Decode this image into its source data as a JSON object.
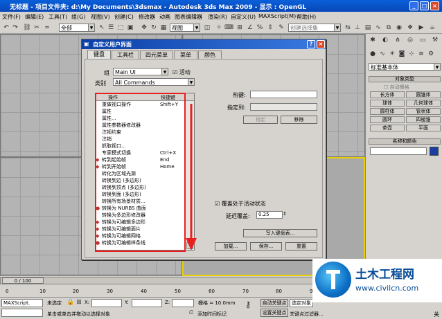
{
  "window": {
    "title": "无标题  - 项目文件夹: d:\\My Documents\\3dsmax   - Autodesk 3ds Max  2009   - 显示 : OpenGL",
    "minimize_icon": "minimize-icon",
    "maximize_icon": "maximize-icon",
    "close_icon": "close-icon"
  },
  "menubar": {
    "items": [
      "文件(F)",
      "编辑(E)",
      "工具(T)",
      "组(G)",
      "视图(V)",
      "创建(C)",
      "修改器",
      "动画",
      "图表编辑器",
      "渲染(R)",
      "自定义(U)",
      "MAXScript(M)",
      "帮助(H)"
    ]
  },
  "toolbar": {
    "selection_filter": "全部",
    "coord_system": "视图",
    "named_selection": "创建选择集"
  },
  "viewports": {
    "top_right_label": "",
    "bottom_left_label": ""
  },
  "command_panel": {
    "category": "标准基本体",
    "rollout_object_type": "对象类型",
    "autogrid": "自动栅格",
    "buttons": [
      "长方体",
      "圆锥体",
      "球体",
      "几何球体",
      "圆柱体",
      "管状体",
      "圆环",
      "四棱锥",
      "茶壶",
      "平面"
    ],
    "rollout_name_color": "名称和颜色",
    "color_swatch": "#1a3fa0"
  },
  "dialog": {
    "title": "自定义用户界面",
    "tabs": [
      "键盘",
      "工具栏",
      "四元菜单",
      "菜单",
      "颜色"
    ],
    "active_tab": 0,
    "group_label": "组",
    "group_value": "Main UI",
    "active_label": "活动",
    "category_label": "类别",
    "category_value": "All Commands",
    "columns": {
      "action": "操作",
      "shortcut": "快捷键"
    },
    "actions": [
      {
        "name": "重做视口操作",
        "shortcut": "Shift+Y",
        "icon": ""
      },
      {
        "name": "属性",
        "shortcut": "",
        "icon": ""
      },
      {
        "name": "属性...",
        "shortcut": "",
        "icon": ""
      },
      {
        "name": "属性参数器修改器",
        "shortcut": "",
        "icon": ""
      },
      {
        "name": "注视约束",
        "shortcut": "",
        "icon": ""
      },
      {
        "name": "注销",
        "shortcut": "",
        "icon": ""
      },
      {
        "name": "抓取视口...",
        "shortcut": "",
        "icon": ""
      },
      {
        "name": "专家模式切换",
        "shortcut": "Ctrl+X",
        "icon": ""
      },
      {
        "name": "转到起始帧",
        "shortcut": "End",
        "icon": "diamond"
      },
      {
        "name": "转到开始帧",
        "shortcut": "Home",
        "icon": "diamond"
      },
      {
        "name": "转化为区域光源",
        "shortcut": "",
        "icon": ""
      },
      {
        "name": "转换到边 (多边形)",
        "shortcut": "",
        "icon": ""
      },
      {
        "name": "转换到顶点 (多边形)",
        "shortcut": "",
        "icon": ""
      },
      {
        "name": "转换到面 (多边形)",
        "shortcut": "",
        "icon": ""
      },
      {
        "name": "转换所有场景材质...",
        "shortcut": "",
        "icon": ""
      },
      {
        "name": "转换为 NURBS 曲面",
        "shortcut": "",
        "icon": "dot"
      },
      {
        "name": "转换为多边形修改器",
        "shortcut": "",
        "icon": ""
      },
      {
        "name": "转换为可编辑多边形",
        "shortcut": "",
        "icon": "diamond"
      },
      {
        "name": "转换为可编辑面片",
        "shortcut": "",
        "icon": "diamond"
      },
      {
        "name": "转换为可编辑网格",
        "shortcut": "",
        "icon": "diamond"
      },
      {
        "name": "转换为可编辑样条线",
        "shortcut": "",
        "icon": "dot"
      }
    ],
    "hotkey_label": "热键:",
    "assigned_to_label": "指定到:",
    "assign_button": "指定",
    "remove_button": "移除",
    "overrides_label": "覆盖处于活动状态",
    "delay_label": "延迟覆盖:",
    "delay_value": "0.25",
    "write_keyboard_button": "写入键盘表...",
    "load_button": "加载...",
    "save_button": "保存...",
    "reset_button": "重置"
  },
  "timeline": {
    "frame_counter": "0 / 100",
    "ticks": [
      "0",
      "10",
      "20",
      "30",
      "40",
      "50",
      "60",
      "70",
      "80",
      "90",
      "100"
    ]
  },
  "statusbar": {
    "maxscript_label": "MAXScript.",
    "selection_status": "未选定",
    "x_label": "X:",
    "y_label": "Y:",
    "z_label": "Z:",
    "grid": "栅格 = 10.0mm",
    "autokey": "自动关键点",
    "set_key": "设置关键点",
    "selected_filter": "选定对象",
    "key_filters": "关键点过滤器...",
    "hint": "单击或单击并拖动以选择对象",
    "add_time_tag": "添加时间标记",
    "trailing_char": "关"
  },
  "watermark": {
    "brand": "土木工程网",
    "url": "www.civilcn.com"
  }
}
